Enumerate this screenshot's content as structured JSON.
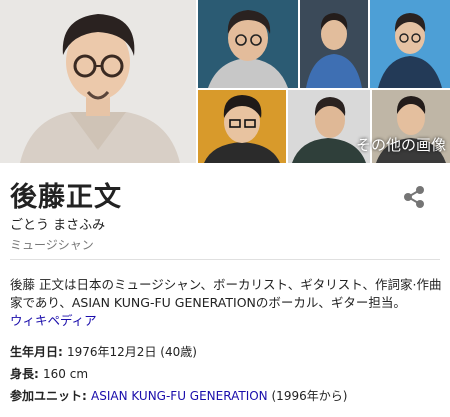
{
  "gallery": {
    "more_images_label": "その他の画像"
  },
  "entity": {
    "name": "後藤正文",
    "reading": "ごとう まさふみ",
    "type": "ミュージシャン",
    "share_icon": "share-icon"
  },
  "description": {
    "text": "後藤 正文は日本のミュージシャン、ボーカリスト、ギタリスト、作詞家·作曲家であり、ASIAN KUNG-FU GENERATIONのボーカル、ギター担当。",
    "source_link": "ウィキペディア"
  },
  "facts": {
    "birth": {
      "label": "生年月日",
      "value": "1976年12月2日 (40歳)"
    },
    "height": {
      "label": "身長",
      "value": "160 cm"
    },
    "unit": {
      "label": "参加ユニット",
      "link": "ASIAN KUNG-FU GENERATION",
      "suffix": "(1996年から)"
    }
  },
  "colors": {
    "link": "#1a0dab",
    "text": "#222222",
    "muted": "#777777"
  }
}
